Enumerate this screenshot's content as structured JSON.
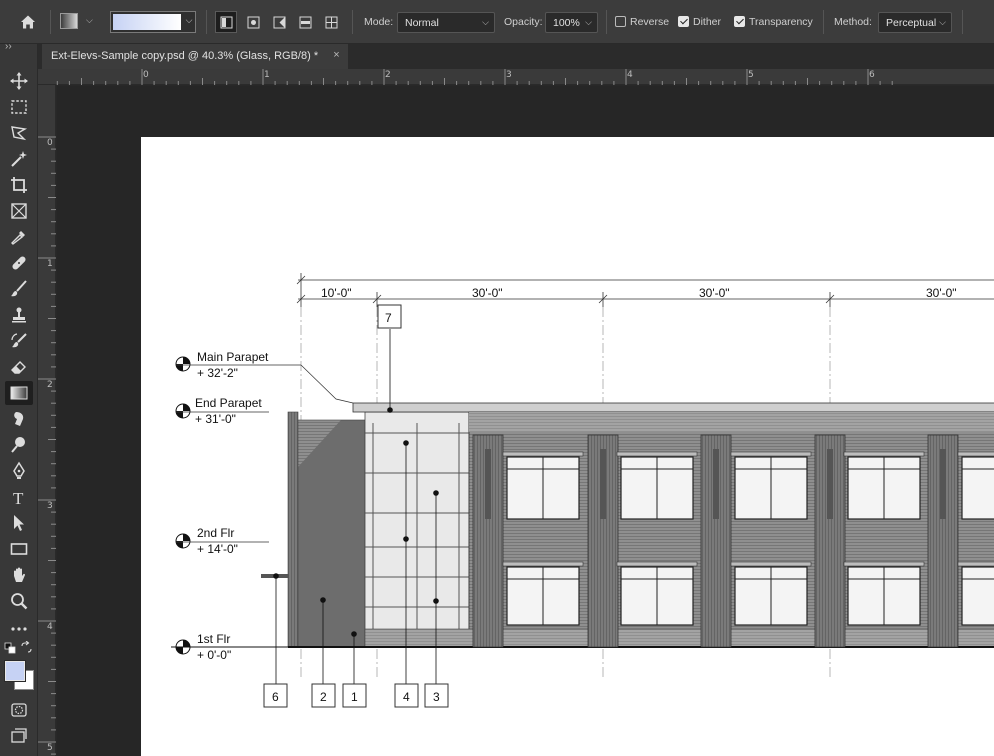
{
  "options_bar": {
    "mode_label": "Mode:",
    "mode_value": "Normal",
    "opacity_label": "Opacity:",
    "opacity_value": "100%",
    "reverse_label": "Reverse",
    "reverse_checked": false,
    "dither_label": "Dither",
    "dither_checked": true,
    "transparency_label": "Transparency",
    "transparency_checked": true,
    "method_label": "Method:",
    "method_value": "Perceptual",
    "gradient_colors": [
      "#c6d2f4",
      "#ffffff"
    ],
    "active_gradient_type": "linear"
  },
  "document_tab": {
    "title": "Ext-Elevs-Sample copy.psd @ 40.3% (Glass, RGB/8) *",
    "close_glyph": "×"
  },
  "toolbar": {
    "tools": [
      "move-tool",
      "marquee-tool",
      "lasso-tool",
      "magic-wand-tool",
      "crop-tool",
      "frame-tool",
      "eyedropper-tool",
      "healing-brush-tool",
      "brush-tool",
      "clone-stamp-tool",
      "history-brush-tool",
      "eraser-tool",
      "gradient-tool",
      "smudge-tool",
      "dodge-tool",
      "pen-tool",
      "type-tool",
      "path-selection-tool",
      "rectangle-tool",
      "hand-tool",
      "zoom-tool",
      "more-tools"
    ],
    "active_tool": "gradient-tool",
    "type_tool_glyph": "T",
    "foreground_color": "#c6d2f4",
    "background_color": "#ffffff"
  },
  "rulers": {
    "horizontal": [
      "0",
      "1",
      "2",
      "3",
      "4",
      "5",
      "6"
    ],
    "vertical": [
      "0",
      "1",
      "2",
      "3",
      "4",
      "5"
    ]
  },
  "drawing": {
    "dimensions": [
      "10'-0\"",
      "30'-0\"",
      "30'-0\"",
      "30'-0\""
    ],
    "levels": [
      {
        "name": "Main Parapet",
        "elev": "+ 32'-2\""
      },
      {
        "name": "End Parapet",
        "elev": "+ 31'-0\""
      },
      {
        "name": "2nd Flr",
        "elev": "+ 14'-0\""
      },
      {
        "name": "1st Flr",
        "elev": "+ 0'-0\""
      }
    ],
    "tags_bottom": [
      "6",
      "2",
      "1",
      "4",
      "3"
    ],
    "tag_top": "7"
  }
}
